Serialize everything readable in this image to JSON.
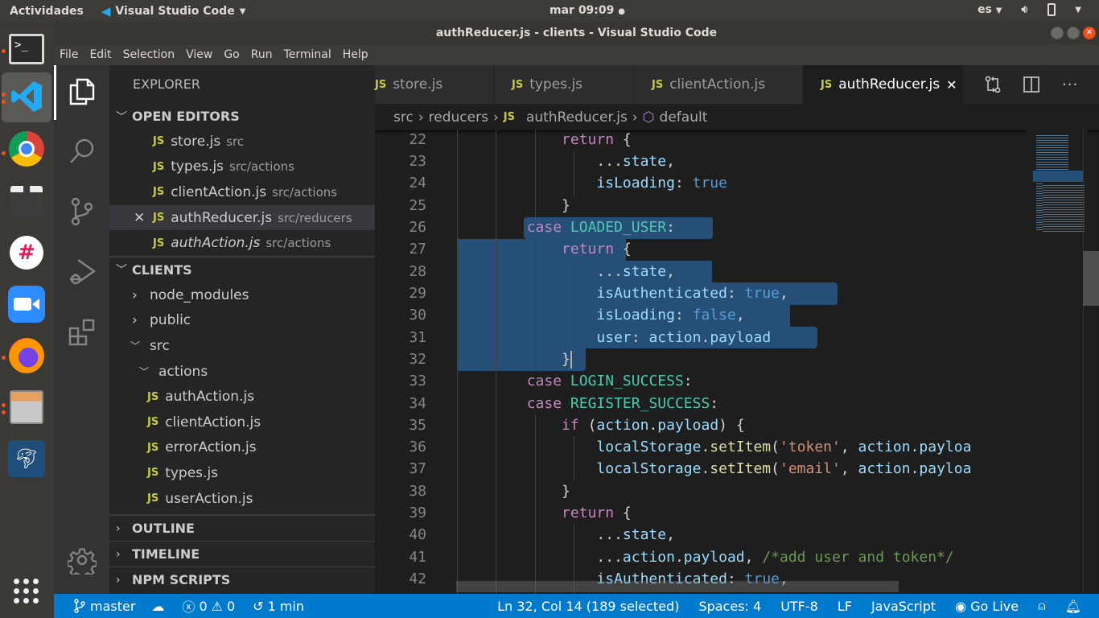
{
  "topbar": {
    "activities": "Actividades",
    "app_name": "Visual Studio Code",
    "clock": "mar 09:09",
    "lang": "es"
  },
  "window": {
    "title": "authReducer.js - clients - Visual Studio Code"
  },
  "menu": [
    "File",
    "Edit",
    "Selection",
    "View",
    "Go",
    "Run",
    "Terminal",
    "Help"
  ],
  "dock": [
    "terminal",
    "vscode",
    "chrome",
    "clapper",
    "slack",
    "zoom",
    "firefox",
    "files",
    "mysql-workbench"
  ],
  "sidebar": {
    "title": "EXPLORER",
    "open_editors": {
      "label": "OPEN EDITORS",
      "items": [
        {
          "name": "store.js",
          "path": "src"
        },
        {
          "name": "types.js",
          "path": "src/actions"
        },
        {
          "name": "clientAction.js",
          "path": "src/actions"
        },
        {
          "name": "authReducer.js",
          "path": "src/reducers"
        },
        {
          "name": "authAction.js",
          "path": "src/actions"
        }
      ]
    },
    "project": {
      "label": "CLIENTS",
      "folders": [
        "node_modules",
        "public",
        "src",
        "actions"
      ],
      "files": [
        "authAction.js",
        "clientAction.js",
        "errorAction.js",
        "types.js",
        "userAction.js"
      ]
    },
    "sections": [
      "OUTLINE",
      "TIMELINE",
      "NPM SCRIPTS"
    ]
  },
  "tabs": [
    {
      "label": "store.js"
    },
    {
      "label": "types.js"
    },
    {
      "label": "clientAction.js"
    },
    {
      "label": "authReducer.js",
      "active": true
    }
  ],
  "breadcrumb": [
    "src",
    "reducers",
    "authReducer.js",
    "default"
  ],
  "editor": {
    "line_numbers": [
      "22",
      "23",
      "24",
      "25",
      "26",
      "27",
      "28",
      "29",
      "30",
      "31",
      "32",
      "33",
      "34",
      "35",
      "36",
      "37",
      "38",
      "39",
      "40",
      "41",
      "42"
    ],
    "selection": "lines 26-32"
  },
  "status": {
    "branch": "master",
    "errors": "0",
    "warnings": "0",
    "time": "1 min",
    "position": "Ln 32, Col 14 (189 selected)",
    "spaces": "Spaces: 4",
    "encoding": "UTF-8",
    "eol": "LF",
    "language": "JavaScript",
    "golive": "Go Live"
  },
  "colors": {
    "accent": "#007acc",
    "selection": "#264f78",
    "js_icon": "#cbcb41"
  }
}
